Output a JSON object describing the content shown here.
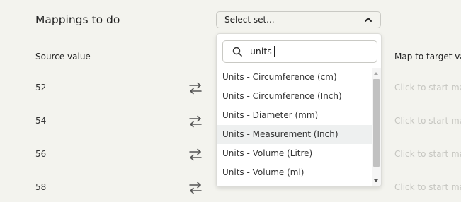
{
  "header": {
    "title": "Mappings to do"
  },
  "set_select": {
    "selected_label": "Select set...",
    "chevron_icon": "chevron-up-icon"
  },
  "columns": {
    "source": "Source value",
    "target": "Map to target valu"
  },
  "rows": [
    {
      "source": "52",
      "target_placeholder": "Click to start mapp"
    },
    {
      "source": "54",
      "target_placeholder": "Click to start mapp"
    },
    {
      "source": "56",
      "target_placeholder": "Click to start mapp"
    },
    {
      "source": "58",
      "target_placeholder": "Click to start mapp"
    }
  ],
  "dropdown": {
    "search_value": "units",
    "options": [
      "Units - Circumference (cm)",
      "Units - Circumference (Inch)",
      "Units - Diameter (mm)",
      "Units - Measurement (Inch)",
      "Units - Volume (Litre)",
      "Units - Volume (ml)"
    ],
    "hovered_option": "Units - Measurement (Inch)"
  },
  "colors": {
    "background": "#f3f3ee",
    "hover_row": "#eef0f0",
    "placeholder_text": "#c6c6c1"
  }
}
